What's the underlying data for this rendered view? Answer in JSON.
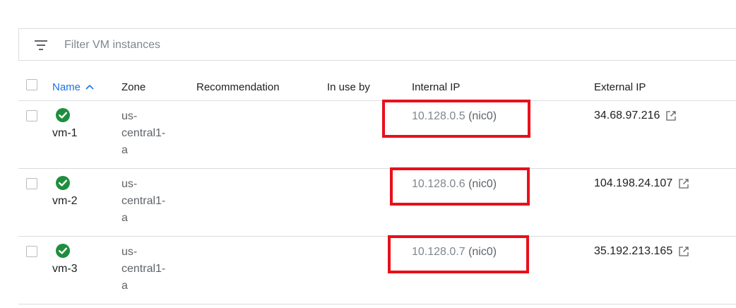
{
  "filter": {
    "placeholder": "Filter VM instances",
    "icon": "filter-list-icon"
  },
  "table": {
    "columns": {
      "name": "Name",
      "zone": "Zone",
      "recommendation": "Recommendation",
      "in_use_by": "In use by",
      "internal_ip": "Internal IP",
      "external_ip": "External IP"
    },
    "sort": {
      "column": "Name",
      "direction": "ascending",
      "icon": "chevron-up-icon"
    },
    "rows": [
      {
        "status_icon": "check-circle-icon",
        "name": "vm-1",
        "zone_lines": [
          "us-",
          "central1-",
          "a"
        ],
        "recommendation": "",
        "in_use_by": "",
        "internal_ip": "10.128.0.5",
        "internal_nic": "(nic0)",
        "external_ip": "34.68.97.216"
      },
      {
        "status_icon": "check-circle-icon",
        "name": "vm-2",
        "zone_lines": [
          "us-",
          "central1-",
          "a"
        ],
        "recommendation": "",
        "in_use_by": "",
        "internal_ip": "10.128.0.6",
        "internal_nic": "(nic0)",
        "external_ip": "104.198.24.107"
      },
      {
        "status_icon": "check-circle-icon",
        "name": "vm-3",
        "zone_lines": [
          "us-",
          "central1-",
          "a"
        ],
        "recommendation": "",
        "in_use_by": "",
        "internal_ip": "10.128.0.7",
        "internal_nic": "(nic0)",
        "external_ip": "35.192.213.165"
      }
    ]
  },
  "colors": {
    "link_blue": "#1a73e8",
    "status_green": "#1e8e3e",
    "highlight_red": "#e8101a",
    "divider": "#dadce0"
  }
}
